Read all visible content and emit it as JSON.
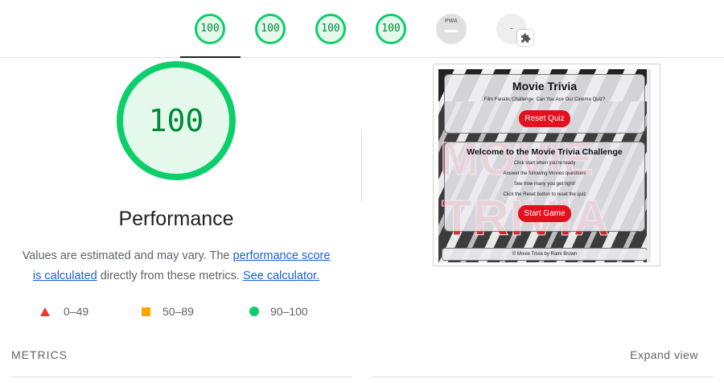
{
  "tabs": [
    {
      "score": "100"
    },
    {
      "score": "100"
    },
    {
      "score": "100"
    },
    {
      "score": "100"
    },
    {
      "label": "PWA",
      "score": ""
    },
    {
      "score": "-"
    }
  ],
  "category": {
    "score": "100",
    "title": "Performance",
    "desc_prefix": "Values are estimated and may vary. The ",
    "link_score": "performance score",
    "link_calc": "is calculated",
    "desc_mid": " directly from these metrics. ",
    "link_calculator": "See calculator."
  },
  "legend": {
    "fail": "0–49",
    "average": "50–89",
    "pass": "90–100"
  },
  "thumbnail": {
    "bg_word_1": "MOVIE",
    "bg_word_2": "TRIVIA",
    "title": "Movie Trivia",
    "tagline": "Film Fanatic Challenge: Can You Ace Our Cinema Quiz?",
    "reset_label": "Reset Quiz",
    "welcome_title": "Welcome to the Movie Trivia Challenge",
    "instructions": [
      "Click start when you're ready",
      "Answer the following Movies questions",
      "See how many you get right!",
      "Click the Reset button to reset the quiz"
    ],
    "start_label": "Start Game",
    "footer": "© Movie Trivia by Rami Brown"
  },
  "metrics": {
    "label": "METRICS",
    "expand": "Expand view"
  },
  "colors": {
    "pass": "#0cce6b",
    "pass_fill": "#e5f8ec",
    "pass_text": "#008a3b",
    "average": "#ffa400",
    "fail": "#eb3a2c",
    "link": "#1a5ed6"
  }
}
